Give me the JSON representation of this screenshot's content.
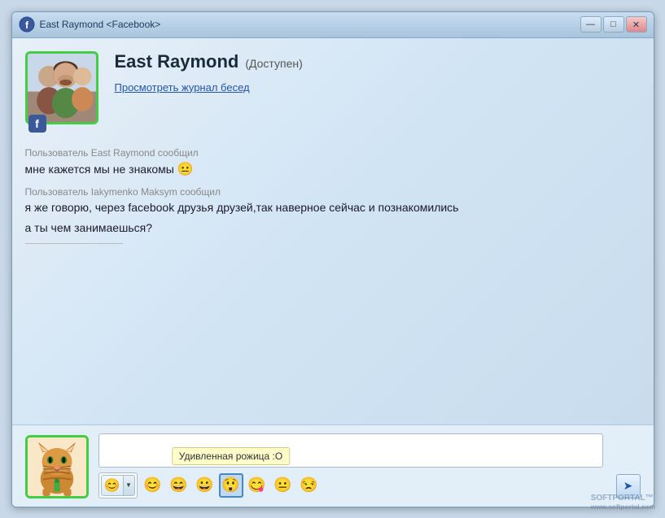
{
  "window": {
    "title": "East Raymond <Facebook>",
    "minimize_label": "—",
    "maximize_label": "□",
    "close_label": "✕"
  },
  "profile": {
    "name": "East Raymond",
    "status": "(Доступен)",
    "view_history_link": "Просмотреть журнал бесед"
  },
  "messages": [
    {
      "sender": "Пользователь East Raymond сообщил",
      "text": "мне кажется мы не знакомы 🙂",
      "has_emoji": true,
      "emoji": "😐"
    },
    {
      "sender": "Пользователь Iakymenko Maksym сообщил",
      "text": "я же говорю, через facebook друзья друзей,так наверное сейчас и познакомились",
      "has_emoji": false
    },
    {
      "sender": "",
      "text": "а ты чем занимаешься?",
      "has_emoji": false
    }
  ],
  "emoji_toolbar": {
    "emojis": [
      "😊",
      "😄",
      "😀",
      "😲",
      "😋",
      "😐",
      "😒"
    ],
    "selected_index": 3,
    "tooltip": "Удивленная рожица :O"
  },
  "send_icon": "➤",
  "facebook_icon": "f",
  "softportal": "SOFTPORTAL™\nwww.softportal.com"
}
